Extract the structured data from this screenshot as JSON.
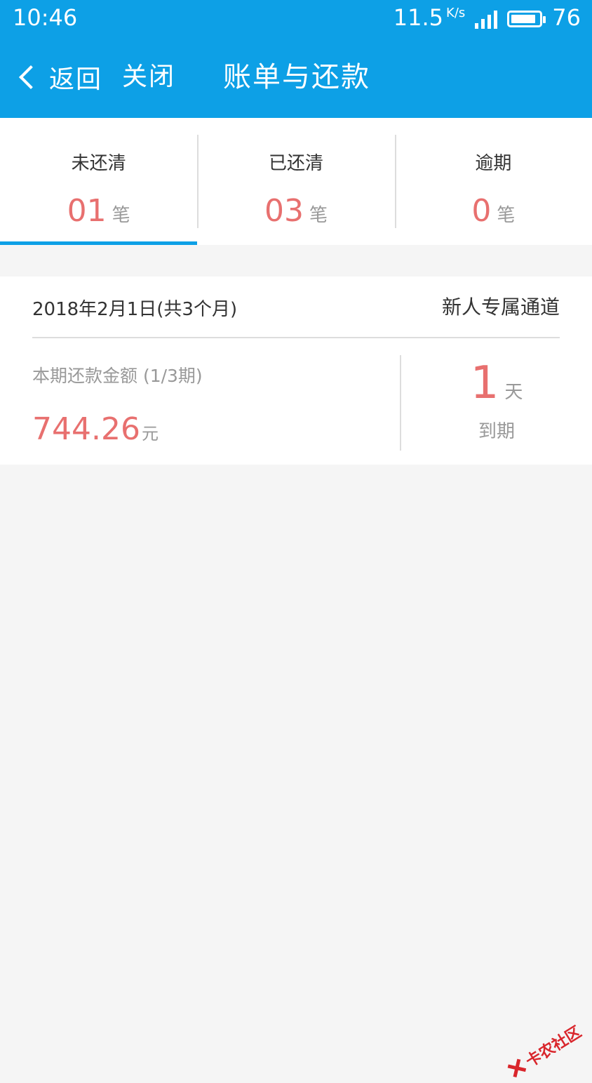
{
  "status_bar": {
    "time": "10:46",
    "speed": "11.5",
    "speed_unit": "K/s",
    "battery": "76"
  },
  "header": {
    "back_label": "返回",
    "close_label": "关闭",
    "title": "账单与还款"
  },
  "tabs": [
    {
      "label": "未还清",
      "count": "01",
      "unit": "笔",
      "active": true
    },
    {
      "label": "已还清",
      "count": "03",
      "unit": "笔",
      "active": false
    },
    {
      "label": "逾期",
      "count": "0",
      "unit": "笔",
      "active": false
    }
  ],
  "bill": {
    "date": "2018年2月1日(共3个月)",
    "channel": "新人专属通道",
    "amount_label": "本期还款金额 (1/3期)",
    "amount": "744.26",
    "amount_unit": "元",
    "due_days": "1",
    "due_days_unit": "天",
    "due_label": "到期"
  },
  "watermark": {
    "text": "卡农社区"
  },
  "colors": {
    "primary": "#0da0e6",
    "accent_red": "#e8706f",
    "background": "#f5f5f5"
  }
}
